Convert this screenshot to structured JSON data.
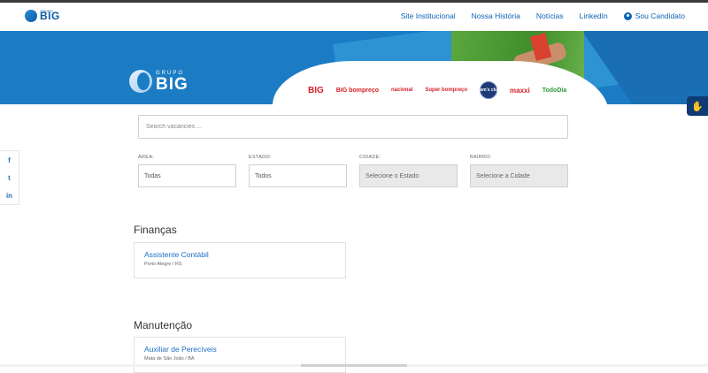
{
  "header": {
    "logo_pre": "GRUPO",
    "logo_text": "BIG",
    "nav": [
      "Site Institucional",
      "Nossa História",
      "Notícias",
      "LinkedIn"
    ],
    "candidate_label": "Sou Candidato"
  },
  "banner": {
    "logo_grupo": "GRUPO",
    "logo_big": "BIG",
    "brands": [
      "BIG",
      "BIG bompreço",
      "nacional",
      "Super bompreço",
      "Sam's club",
      "maxxi",
      "TodoDia"
    ]
  },
  "search": {
    "placeholder": "Search vacancies ..."
  },
  "filters": [
    {
      "label": "ÁREA:",
      "value": "Todas"
    },
    {
      "label": "ESTADO:",
      "value": "Todos"
    },
    {
      "label": "CIDADE:",
      "value": "Selecione o Estado"
    },
    {
      "label": "BAIRRO:",
      "value": "Selecione a Cidade"
    }
  ],
  "social": [
    "f",
    "t",
    "in"
  ],
  "sections": [
    {
      "title": "Finanças",
      "jobs": [
        {
          "title": "Assistente Contábil",
          "location": "Porto Alegre / RS"
        }
      ]
    },
    {
      "title": "Manutenção",
      "jobs": [
        {
          "title": "Auxiliar de Perecíveis",
          "location": "Mata de São João / BA"
        }
      ]
    }
  ],
  "colors": {
    "brand_blue": "#1b7cc4",
    "link_blue": "#1b6fc4",
    "accent_navy": "#0e3b73"
  }
}
